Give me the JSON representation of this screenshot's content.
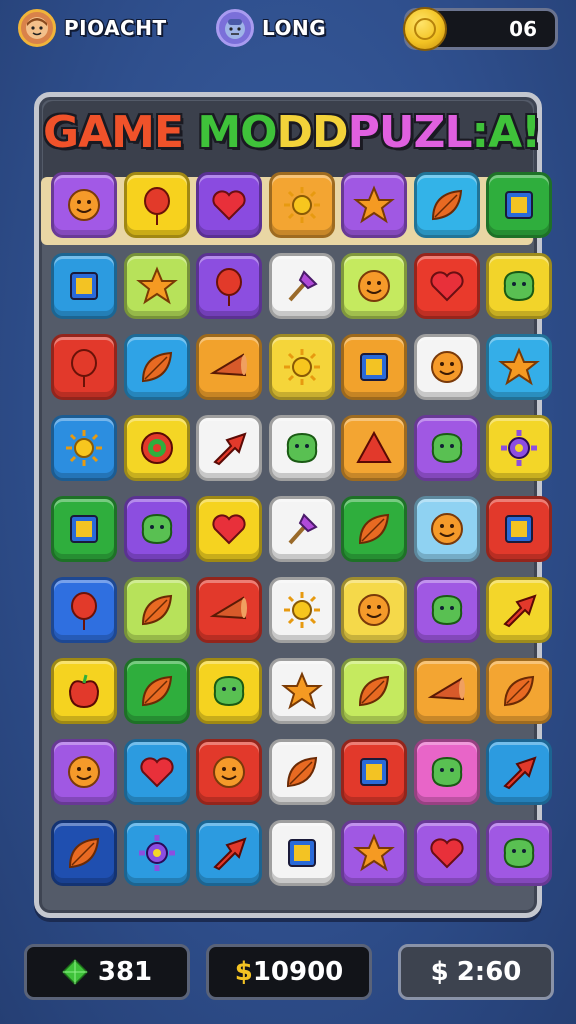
{
  "top_bar": {
    "player1": {
      "name": "PIOACHT",
      "avatar_icon": "face-icon"
    },
    "player2": {
      "name": "LONG",
      "avatar_icon": "face-icon"
    },
    "coins": {
      "value": "06",
      "icon": "gold-coin-icon"
    }
  },
  "board": {
    "title_parts": [
      "GAME",
      " MO",
      "DD",
      "PUZL",
      ":A!"
    ],
    "tiles": [
      [
        {
          "color": "#a259e6",
          "icon": "smile"
        },
        {
          "color": "#f7d21e",
          "icon": "balloon"
        },
        {
          "color": "#8a4be0",
          "icon": "heart"
        },
        {
          "color": "#f3a532",
          "icon": "sun"
        },
        {
          "color": "#a058e3",
          "icon": "star"
        },
        {
          "color": "#33b3e8",
          "icon": "leaf"
        },
        {
          "color": "#2fae3d",
          "icon": "square"
        }
      ],
      [
        {
          "color": "#2c9be0",
          "icon": "square"
        },
        {
          "color": "#b7e25a",
          "icon": "star"
        },
        {
          "color": "#8c4ee0",
          "icon": "balloon"
        },
        {
          "color": "#f4f4f4",
          "icon": "brush"
        },
        {
          "color": "#c5ea5f",
          "icon": "smile"
        },
        {
          "color": "#e93a2c",
          "icon": "heart"
        },
        {
          "color": "#f2d42a",
          "icon": "blob"
        }
      ],
      [
        {
          "color": "#e2392b",
          "icon": "balloon"
        },
        {
          "color": "#2fa3e6",
          "icon": "leaf"
        },
        {
          "color": "#f2a22c",
          "icon": "cone"
        },
        {
          "color": "#f5d53a",
          "icon": "sun"
        },
        {
          "color": "#f2a22c",
          "icon": "square"
        },
        {
          "color": "#f4f4f4",
          "icon": "smile"
        },
        {
          "color": "#34aee8",
          "icon": "star"
        }
      ],
      [
        {
          "color": "#2c8ee0",
          "icon": "sun"
        },
        {
          "color": "#f4d625",
          "icon": "target"
        },
        {
          "color": "#f4f4f4",
          "icon": "arrow"
        },
        {
          "color": "#f4f4f4",
          "icon": "blob"
        },
        {
          "color": "#f3a532",
          "icon": "triangle"
        },
        {
          "color": "#a058e3",
          "icon": "blob"
        },
        {
          "color": "#f3d628",
          "icon": "gear"
        }
      ],
      [
        {
          "color": "#2fae3d",
          "icon": "square"
        },
        {
          "color": "#8c4ee0",
          "icon": "blob"
        },
        {
          "color": "#f5d320",
          "icon": "heart"
        },
        {
          "color": "#f4f4f4",
          "icon": "brush"
        },
        {
          "color": "#2fae3d",
          "icon": "leaf"
        },
        {
          "color": "#8fd2f2",
          "icon": "smile"
        },
        {
          "color": "#e2392b",
          "icon": "square"
        }
      ],
      [
        {
          "color": "#2f6fe0",
          "icon": "balloon"
        },
        {
          "color": "#b7e25a",
          "icon": "leaf"
        },
        {
          "color": "#e2392b",
          "icon": "cone"
        },
        {
          "color": "#f4f4f4",
          "icon": "sun"
        },
        {
          "color": "#f5d94a",
          "icon": "smile"
        },
        {
          "color": "#a058e3",
          "icon": "blob"
        },
        {
          "color": "#f3d62a",
          "icon": "arrow"
        }
      ],
      [
        {
          "color": "#f5d320",
          "icon": "apple"
        },
        {
          "color": "#2fae3d",
          "icon": "leaf"
        },
        {
          "color": "#f5d320",
          "icon": "blob"
        },
        {
          "color": "#f4f4f4",
          "icon": "star"
        },
        {
          "color": "#c5ea5f",
          "icon": "leaf"
        },
        {
          "color": "#f3a532",
          "icon": "cone"
        },
        {
          "color": "#f3a532",
          "icon": "leaf"
        }
      ],
      [
        {
          "color": "#a058e3",
          "icon": "smile"
        },
        {
          "color": "#2c9be0",
          "icon": "heart"
        },
        {
          "color": "#e2392b",
          "icon": "smile"
        },
        {
          "color": "#f4f4f4",
          "icon": "leaf"
        },
        {
          "color": "#e2392b",
          "icon": "square"
        },
        {
          "color": "#e865c8",
          "icon": "blob"
        },
        {
          "color": "#2c9be0",
          "icon": "arrow"
        }
      ],
      [
        {
          "color": "#1f4fb0",
          "icon": "leaf"
        },
        {
          "color": "#2c9be0",
          "icon": "gear"
        },
        {
          "color": "#2c9be0",
          "icon": "arrow"
        },
        {
          "color": "#f4f4f4",
          "icon": "square"
        },
        {
          "color": "#a058e3",
          "icon": "star"
        },
        {
          "color": "#a058e3",
          "icon": "heart"
        },
        {
          "color": "#a058e3",
          "icon": "blob"
        }
      ]
    ]
  },
  "bottom_bar": {
    "gems": {
      "value": "381",
      "icon": "green-gem-icon"
    },
    "money": {
      "symbol": "$",
      "value": "10900"
    },
    "timer": {
      "symbol": "$",
      "value": "2:60"
    }
  }
}
